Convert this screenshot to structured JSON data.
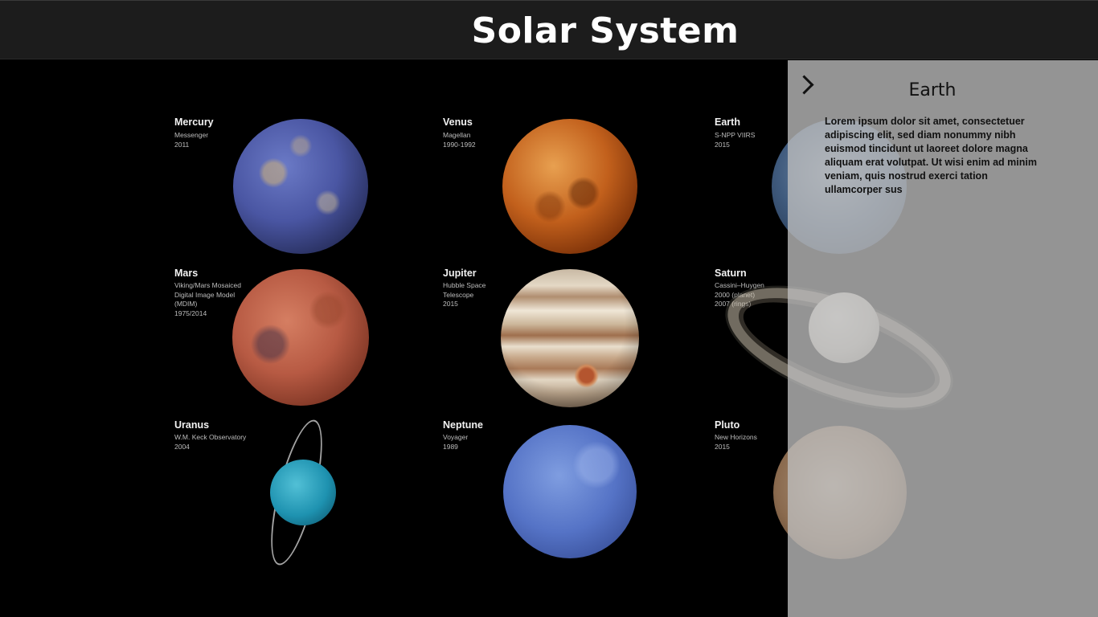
{
  "header": {
    "title": "Solar System"
  },
  "planets": [
    {
      "name": "Mercury",
      "info": [
        "Messenger",
        "2011"
      ]
    },
    {
      "name": "Venus",
      "info": [
        "Magellan",
        "1990-1992"
      ]
    },
    {
      "name": "Earth",
      "info": [
        "S-NPP VIIRS",
        "2015"
      ]
    },
    {
      "name": "Mars",
      "info": [
        "Viking/Mars Mosaiced",
        "Digital Image Model",
        "(MDIM)",
        "1975/2014"
      ]
    },
    {
      "name": "Jupiter",
      "info": [
        "Hubble Space",
        "Telescope",
        "2015"
      ]
    },
    {
      "name": "Saturn",
      "info": [
        "Cassini–Huygen",
        "2000 (planet)",
        "2007 (rings)"
      ]
    },
    {
      "name": "Uranus",
      "info": [
        "W.M. Keck Observatory",
        "2004"
      ]
    },
    {
      "name": "Neptune",
      "info": [
        "Voyager",
        "1989"
      ]
    },
    {
      "name": "Pluto",
      "info": [
        "New Horizons",
        "2015"
      ]
    }
  ],
  "panel": {
    "title": "Earth",
    "text": "Lorem ipsum dolor sit amet, consectetuer adipiscing elit, sed diam nonummy nibh euismod tincidunt ut laoreet dolore magna aliquam erat volutpat. Ut wisi enim ad minim veniam, quis nostrud exerci tation ullamcorper sus"
  }
}
